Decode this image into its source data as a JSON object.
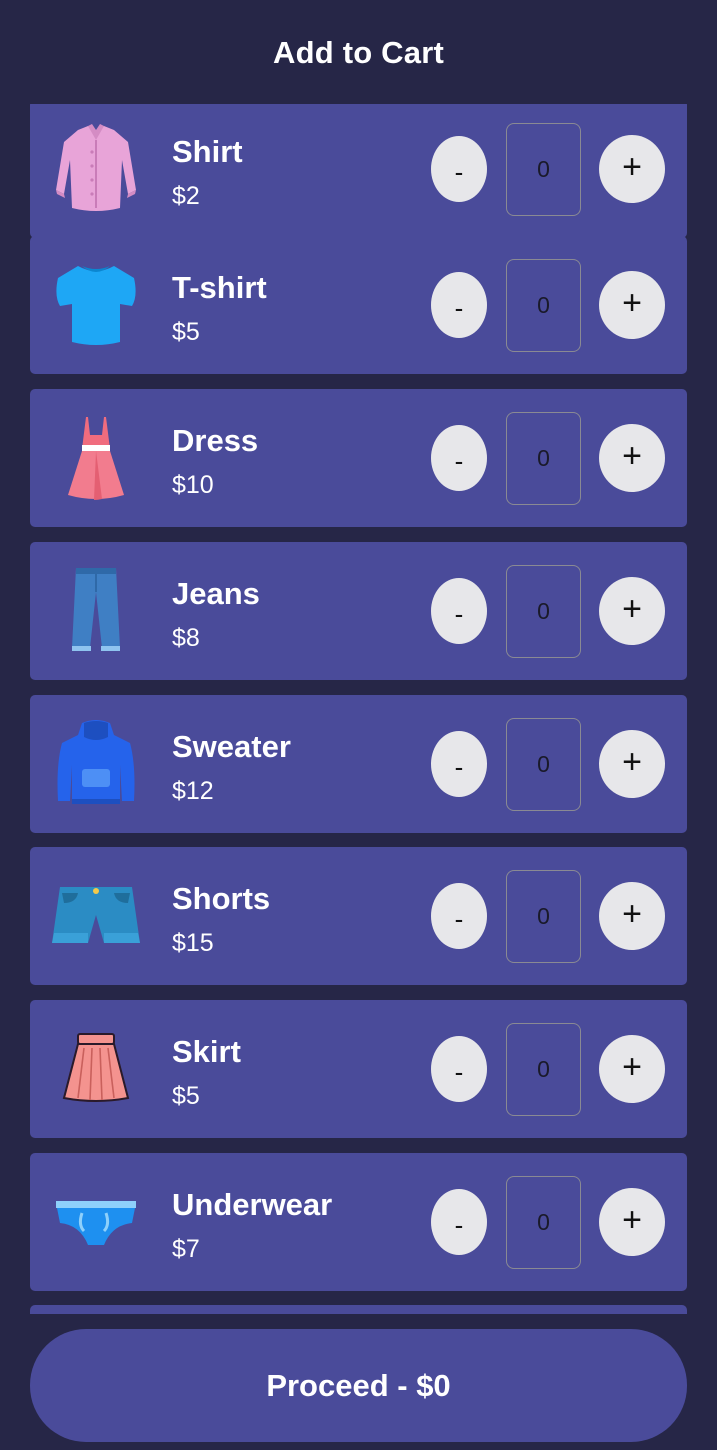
{
  "header": {
    "title": "Add to Cart"
  },
  "items": [
    {
      "name": "Shirt",
      "price": "$2",
      "qty": "0",
      "icon": "shirt-icon",
      "minus": "-",
      "plus": "+"
    },
    {
      "name": "T-shirt",
      "price": "$5",
      "qty": "0",
      "icon": "tshirt-icon",
      "minus": "-",
      "plus": "+"
    },
    {
      "name": "Dress",
      "price": "$10",
      "qty": "0",
      "icon": "dress-icon",
      "minus": "-",
      "plus": "+"
    },
    {
      "name": "Jeans",
      "price": "$8",
      "qty": "0",
      "icon": "jeans-icon",
      "minus": "-",
      "plus": "+"
    },
    {
      "name": "Sweater",
      "price": "$12",
      "qty": "0",
      "icon": "sweater-icon",
      "minus": "-",
      "plus": "+"
    },
    {
      "name": "Shorts",
      "price": "$15",
      "qty": "0",
      "icon": "shorts-icon",
      "minus": "-",
      "plus": "+"
    },
    {
      "name": "Skirt",
      "price": "$5",
      "qty": "0",
      "icon": "skirt-icon",
      "minus": "-",
      "plus": "+"
    },
    {
      "name": "Underwear",
      "price": "$7",
      "qty": "0",
      "icon": "underwear-icon",
      "minus": "-",
      "plus": "+"
    }
  ],
  "footer": {
    "proceed_label": "Proceed - $0"
  },
  "colors": {
    "background": "#262647",
    "card": "#4a4b9a",
    "button": "#e7e7ea"
  }
}
